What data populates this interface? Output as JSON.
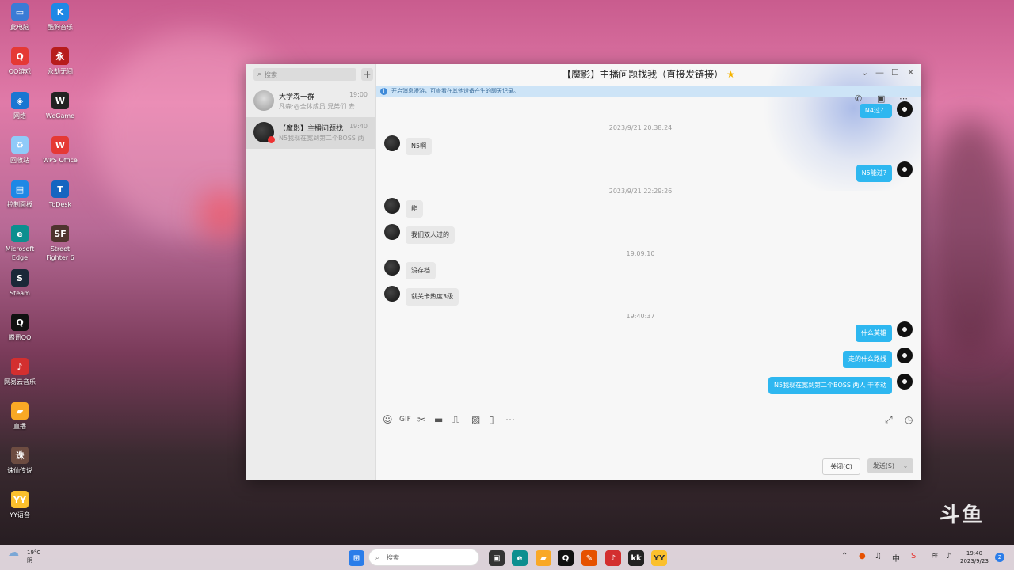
{
  "desktop": {
    "icons": [
      {
        "label": "此电脑",
        "color": "#3a7bd5",
        "glyph": "▭"
      },
      {
        "label": "酷狗音乐",
        "color": "#1e88e5",
        "glyph": "K"
      },
      {
        "label": "QQ游戏",
        "color": "#e53935",
        "glyph": "Q"
      },
      {
        "label": "永劫无间",
        "color": "#b71c1c",
        "glyph": "永"
      },
      {
        "label": "网络",
        "color": "#1976d2",
        "glyph": "◈"
      },
      {
        "label": "WeGame",
        "color": "#222",
        "glyph": "W"
      },
      {
        "label": "回收站",
        "color": "#90caf9",
        "glyph": "♻"
      },
      {
        "label": "WPS Office",
        "color": "#e53935",
        "glyph": "W"
      },
      {
        "label": "控制面板",
        "color": "#1e88e5",
        "glyph": "▤"
      },
      {
        "label": "ToDesk",
        "color": "#1565c0",
        "glyph": "T"
      },
      {
        "label": "Microsoft Edge",
        "color": "#0c8f8f",
        "glyph": "e"
      },
      {
        "label": "Street Fighter 6",
        "color": "#4e342e",
        "glyph": "SF"
      },
      {
        "label": "Steam",
        "color": "#1b2838",
        "glyph": "S"
      },
      {
        "label": "腾讯QQ",
        "color": "#111",
        "glyph": "Q"
      },
      {
        "label": "网易云音乐",
        "color": "#d32f2f",
        "glyph": "♪"
      },
      {
        "label": "直播",
        "color": "#f9a825",
        "glyph": "▰"
      },
      {
        "label": "诛仙传说",
        "color": "#6d4c41",
        "glyph": "诛"
      },
      {
        "label": "YY语音",
        "color": "#fbc02d",
        "glyph": "YY"
      }
    ]
  },
  "qq": {
    "search_placeholder": "搜索",
    "conversations": [
      {
        "name": "大学森一群",
        "time": "19:00",
        "preview": "凡森:@全体成员 兄弟们 去"
      },
      {
        "name": "【魔影】主播问题找",
        "time": "19:40",
        "preview": "N5我现在宽到第二个BOSS 两"
      }
    ],
    "title": "【魔影】主播问题找我（直接发链接）",
    "notice": "开启消息漫游，可查看在其他设备产生的聊天记录。",
    "messages": [
      {
        "kind": "out",
        "text": "N4过？"
      },
      {
        "kind": "time",
        "text": "2023/9/21 20:38:24"
      },
      {
        "kind": "in",
        "text": "N5啊"
      },
      {
        "kind": "out",
        "text": "N5能过?"
      },
      {
        "kind": "time",
        "text": "2023/9/21 22:29:26"
      },
      {
        "kind": "in",
        "text": "能"
      },
      {
        "kind": "in",
        "text": "我们双人过的"
      },
      {
        "kind": "time",
        "text": "19:09:10"
      },
      {
        "kind": "in",
        "text": "没存档"
      },
      {
        "kind": "in",
        "text": "就关卡热度3级"
      },
      {
        "kind": "time",
        "text": "19:40:37"
      },
      {
        "kind": "out",
        "text": "什么英雄"
      },
      {
        "kind": "out",
        "text": "走的什么路线"
      },
      {
        "kind": "out",
        "text": "N5我现在宽到第二个BOSS  两人 干不动"
      }
    ],
    "buttons": {
      "close": "关闭(C)",
      "send": "发送(S)"
    }
  },
  "taskbar": {
    "weather_temp": "19°C",
    "weather_desc": "阴",
    "search": "搜索",
    "ime": "中",
    "time": "19:40",
    "date": "2023/9/23",
    "notify_count": "2"
  },
  "watermark": "斗鱼"
}
